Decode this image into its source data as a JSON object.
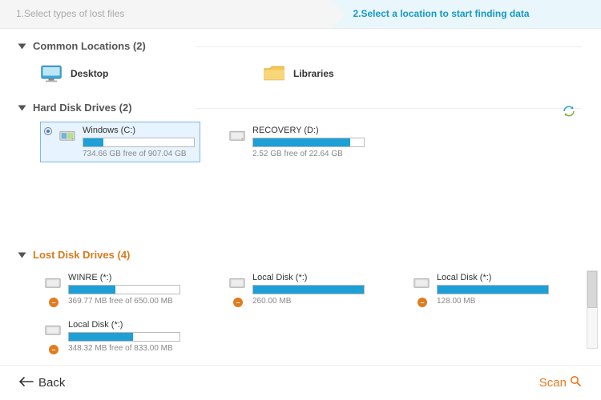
{
  "steps": {
    "step1": "1.Select types of lost files",
    "step2": "2.Select a location to start finding data"
  },
  "sections": {
    "common": {
      "title": "Common Locations (2)"
    },
    "hard": {
      "title": "Hard Disk Drives (2)"
    },
    "lost": {
      "title": "Lost Disk Drives (4)"
    }
  },
  "common_locations": [
    {
      "id": "desktop",
      "label": "Desktop"
    },
    {
      "id": "libraries",
      "label": "Libraries"
    }
  ],
  "hard_drives": [
    {
      "id": "c",
      "name": "Windows (C:)",
      "info": "734.66 GB free of 907.04 GB",
      "fill_pct": 18,
      "selected": true,
      "color": "blue"
    },
    {
      "id": "d",
      "name": "RECOVERY (D:)",
      "info": "2.52 GB free of 22.64 GB",
      "fill_pct": 88,
      "selected": false,
      "color": "blue"
    }
  ],
  "lost_drives": [
    {
      "id": "l0",
      "name": "WINRE (*:)",
      "info": "369.77 MB free of 650.00 MB",
      "fill_pct": 42,
      "color": "blue"
    },
    {
      "id": "l1",
      "name": "Local Disk (*:)",
      "info": "260.00 MB",
      "fill_pct": 100,
      "color": "orange"
    },
    {
      "id": "l2",
      "name": "Local Disk (*:)",
      "info": "128.00 MB",
      "fill_pct": 100,
      "color": "orange"
    },
    {
      "id": "l3",
      "name": "Local Disk (*:)",
      "info": "348.32 MB free of 833.00 MB",
      "fill_pct": 58,
      "color": "blue"
    }
  ],
  "footer": {
    "back": "Back",
    "scan": "Scan"
  }
}
